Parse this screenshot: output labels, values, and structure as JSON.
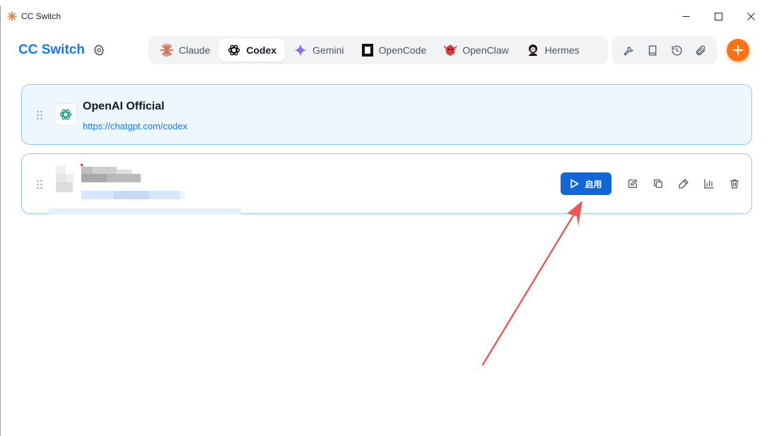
{
  "window": {
    "title": "CC Switch"
  },
  "header": {
    "brand": "CC Switch",
    "tabs": [
      {
        "label": "Claude",
        "icon": "claude-icon",
        "active": false
      },
      {
        "label": "Codex",
        "icon": "openai-icon",
        "active": true
      },
      {
        "label": "Gemini",
        "icon": "gemini-icon",
        "active": false
      },
      {
        "label": "OpenCode",
        "icon": "opencode-icon",
        "active": false
      },
      {
        "label": "OpenClaw",
        "icon": "openclaw-icon",
        "active": false
      },
      {
        "label": "Hermes",
        "icon": "hermes-icon",
        "active": false
      }
    ],
    "tools": [
      "wrench-icon",
      "book-icon",
      "history-icon",
      "paperclip-icon"
    ]
  },
  "providers": [
    {
      "name": "OpenAI Official",
      "url": "https://chatgpt.com/codex",
      "active": true
    },
    {
      "name_redacted": true,
      "enable_label": "启用",
      "actions": [
        "edit-icon",
        "copy-icon",
        "test-icon",
        "usage-icon",
        "delete-icon"
      ]
    }
  ],
  "colors": {
    "brand": "#1677ff",
    "enable_button": "#1366d6",
    "add_button": "#f97316",
    "annotation_arrow": "#f25454",
    "active_card_bg": "#eef6ff",
    "card_border": "#93c5fd"
  }
}
